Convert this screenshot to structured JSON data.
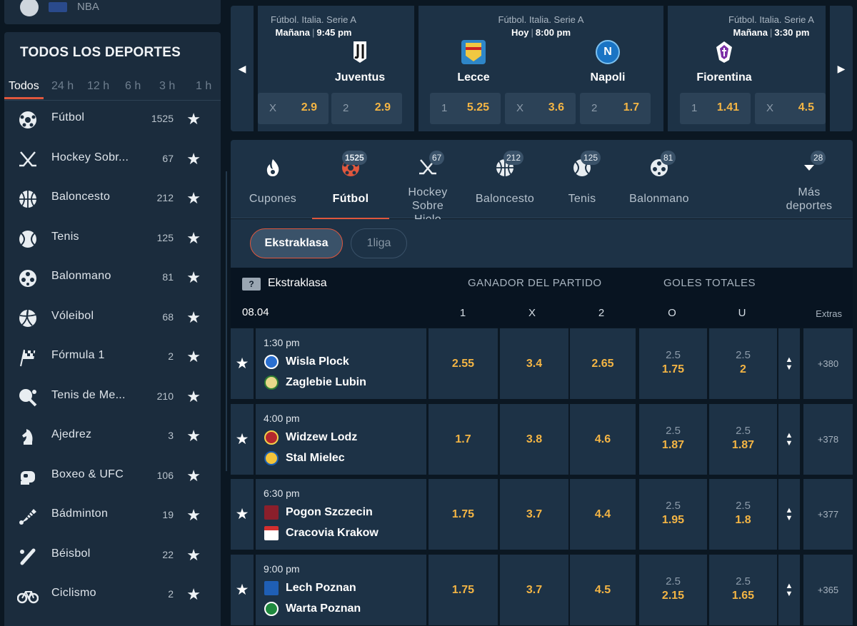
{
  "sidebar_top": {
    "label": "NBA"
  },
  "sidebar": {
    "title": "TODOS LOS DEPORTES",
    "time_filters": [
      "Todos",
      "24 h",
      "12 h",
      "6 h",
      "3 h",
      "1 h"
    ],
    "active_filter": "Todos",
    "sports": [
      {
        "name": "Fútbol",
        "count": "1525",
        "icon": "soccer-ball-icon"
      },
      {
        "name": "Hockey Sobr...",
        "count": "67",
        "icon": "hockey-sticks-icon"
      },
      {
        "name": "Baloncesto",
        "count": "212",
        "icon": "basketball-icon"
      },
      {
        "name": "Tenis",
        "count": "125",
        "icon": "tennis-ball-icon"
      },
      {
        "name": "Balonmano",
        "count": "81",
        "icon": "handball-icon"
      },
      {
        "name": "Vóleibol",
        "count": "68",
        "icon": "volleyball-icon"
      },
      {
        "name": "Fórmula 1",
        "count": "2",
        "icon": "checkered-flag-icon"
      },
      {
        "name": "Tenis de Me...",
        "count": "210",
        "icon": "table-tennis-icon"
      },
      {
        "name": "Ajedrez",
        "count": "3",
        "icon": "chess-knight-icon"
      },
      {
        "name": "Boxeo & UFC",
        "count": "106",
        "icon": "boxing-glove-icon"
      },
      {
        "name": "Bádminton",
        "count": "19",
        "icon": "shuttlecock-icon"
      },
      {
        "name": "Béisbol",
        "count": "22",
        "icon": "baseball-bat-icon"
      },
      {
        "name": "Ciclismo",
        "count": "2",
        "icon": "bicycle-icon"
      }
    ]
  },
  "featured": [
    {
      "league": "Fútbol. Italia. Serie A",
      "day": "Mañana",
      "time": "9:45 pm",
      "home": "",
      "away": "Juventus",
      "odds": [
        {
          "label": "X",
          "value": "2.9"
        },
        {
          "label": "2",
          "value": "2.9"
        }
      ]
    },
    {
      "league": "Fútbol. Italia. Serie A",
      "day": "Hoy",
      "time": "8:00 pm",
      "home": "Lecce",
      "away": "Napoli",
      "odds": [
        {
          "label": "1",
          "value": "5.25"
        },
        {
          "label": "X",
          "value": "3.6"
        },
        {
          "label": "2",
          "value": "1.7"
        }
      ]
    },
    {
      "league": "Fútbol. Italia. Serie A",
      "day": "Mañana",
      "time": "3:30 pm",
      "home": "Fiorentina",
      "away": "",
      "odds": [
        {
          "label": "1",
          "value": "1.41"
        },
        {
          "label": "X",
          "value": "4.5"
        }
      ]
    }
  ],
  "sport_tabs": [
    {
      "label": "Cupones",
      "badge": "",
      "icon": "flame-icon"
    },
    {
      "label": "Fútbol",
      "badge": "1525",
      "icon": "soccer-ball-icon"
    },
    {
      "label": "Hockey Sobre Hielo",
      "badge": "67",
      "icon": "hockey-sticks-icon"
    },
    {
      "label": "Baloncesto",
      "badge": "212",
      "icon": "basketball-icon"
    },
    {
      "label": "Tenis",
      "badge": "125",
      "icon": "tennis-ball-icon"
    },
    {
      "label": "Balonmano",
      "badge": "81",
      "icon": "handball-icon"
    },
    {
      "label": "Más deportes",
      "badge": "28",
      "icon": "chevron-down-icon"
    }
  ],
  "league_pills": [
    {
      "label": "Ekstraklasa",
      "active": true
    },
    {
      "label": "1liga",
      "active": false
    }
  ],
  "market": {
    "badge": "?",
    "league": "Ekstraklasa",
    "group_winner": "GANADOR DEL PARTIDO",
    "group_totals": "GOLES TOTALES",
    "date": "08.04",
    "cols": [
      "1",
      "X",
      "2",
      "O",
      "U"
    ],
    "extras": "Extras"
  },
  "matches": [
    {
      "time": "1:30 pm",
      "home": "Wisla Plock",
      "away": "Zaglebie Lubin",
      "o1": "2.55",
      "ox": "3.4",
      "o2": "2.65",
      "over_line": "2.5",
      "over": "1.75",
      "under_line": "2.5",
      "under": "2",
      "extras": "+380"
    },
    {
      "time": "4:00 pm",
      "home": "Widzew Lodz",
      "away": "Stal Mielec",
      "o1": "1.7",
      "ox": "3.8",
      "o2": "4.6",
      "over_line": "2.5",
      "over": "1.87",
      "under_line": "2.5",
      "under": "1.87",
      "extras": "+378"
    },
    {
      "time": "6:30 pm",
      "home": "Pogon Szczecin",
      "away": "Cracovia Krakow",
      "o1": "1.75",
      "ox": "3.7",
      "o2": "4.4",
      "over_line": "2.5",
      "over": "1.95",
      "under_line": "2.5",
      "under": "1.8",
      "extras": "+377"
    },
    {
      "time": "9:00 pm",
      "home": "Lech Poznan",
      "away": "Warta Poznan",
      "o1": "1.75",
      "ox": "3.7",
      "o2": "4.5",
      "over_line": "2.5",
      "over": "2.15",
      "under_line": "2.5",
      "under": "1.65",
      "extras": "+365"
    }
  ],
  "colors": {
    "accent": "#e0573d",
    "odds": "#f4b544",
    "panel": "#1d3246",
    "background": "#0b1722"
  }
}
